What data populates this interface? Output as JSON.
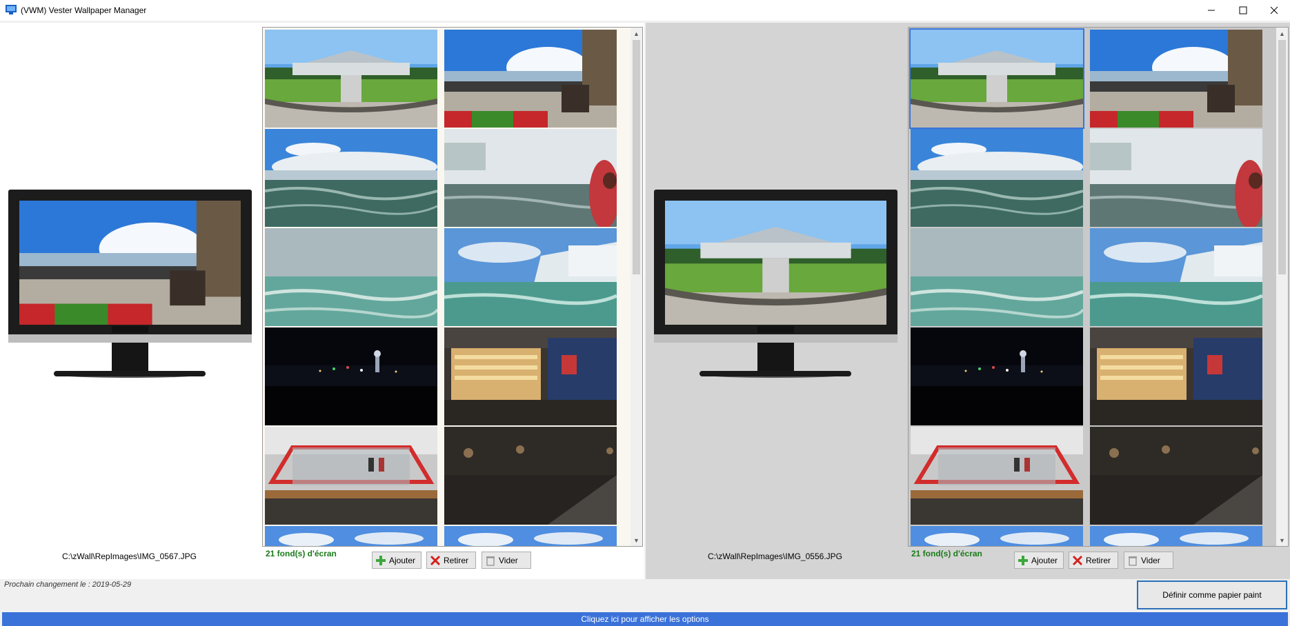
{
  "window": {
    "title": "(VWM) Vester Wallpaper Manager"
  },
  "left": {
    "current_path": "C:\\zWall\\RepImages\\IMG_0567.JPG",
    "count_label": "21 fond(s) d'écran",
    "add_label": "Ajouter",
    "remove_label": "Retirer",
    "clear_label": "Vider"
  },
  "right": {
    "current_path": "C:\\zWall\\RepImages\\IMG_0556.JPG",
    "count_label": "21 fond(s) d'écran",
    "add_label": "Ajouter",
    "remove_label": "Retirer",
    "clear_label": "Vider"
  },
  "status": {
    "next_change": "Prochain changement le : 2019-05-29",
    "set_wallpaper_label": "Définir comme papier paint",
    "options_label": "Cliquez ici pour afficher les options"
  },
  "thumbnails": [
    {
      "name": "garden-building"
    },
    {
      "name": "falls-viewpoint-crowd"
    },
    {
      "name": "waterfall-blue-sky"
    },
    {
      "name": "waterfall-mist-person"
    },
    {
      "name": "waterfall-mist-close"
    },
    {
      "name": "horseshoe-falls"
    },
    {
      "name": "night-skyline"
    },
    {
      "name": "hall-of-fame-display"
    },
    {
      "name": "hockey-net-display"
    },
    {
      "name": "dark-display-case"
    },
    {
      "name": "sky-partial"
    },
    {
      "name": "sky-partial-2"
    }
  ],
  "colors": {
    "accent": "#3b72d9",
    "count_green": "#1a7a1a",
    "focus_border": "#2a6fb8"
  }
}
